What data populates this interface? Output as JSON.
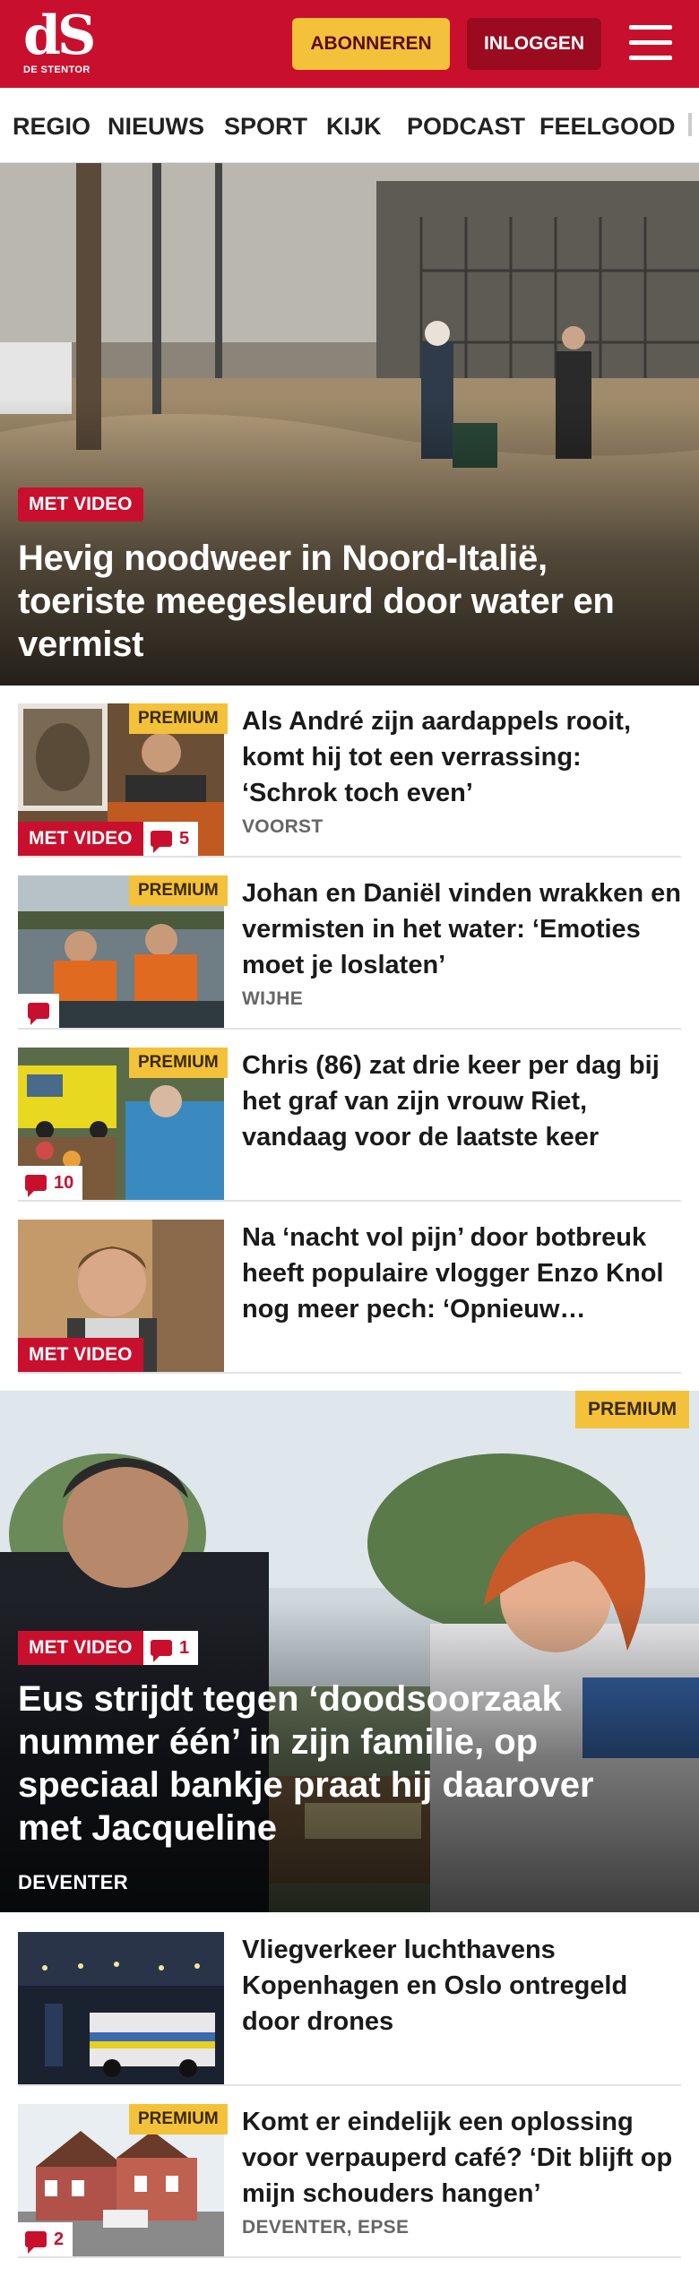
{
  "brand": {
    "logo_mark": "dS",
    "logo_sub": "DE STENTOR",
    "red": "#c8102e",
    "yellow": "#f4c13a"
  },
  "header": {
    "subscribe_label": "ABONNEREN",
    "login_label": "INLOGGEN"
  },
  "nav": {
    "items": [
      "REGIO",
      "NIEUWS",
      "SPORT",
      "KIJK",
      "PODCAST",
      "FEELGOOD"
    ]
  },
  "hero": {
    "badge": "MET VIDEO",
    "title": "Hevig noodweer in Noord-Italië, toeriste meegesleurd door water en vermist"
  },
  "articles": [
    {
      "premium": "PREMIUM",
      "video": "MET VIDEO",
      "comments": "5",
      "title": "Als André zijn aardappels rooit, komt hij tot een verrassing: ‘Schrok toch even’",
      "location": "VOORST"
    },
    {
      "premium": "PREMIUM",
      "title": "Johan en Daniël vinden wrakken en vermisten in het water: ‘Emoties moet je loslaten’",
      "location": "WIJHE"
    },
    {
      "premium": "PREMIUM",
      "comments": "10",
      "title": "Chris (86) zat drie keer per dag bij het graf van zijn vrouw Riet, vandaag voor de laatste keer"
    },
    {
      "video": "MET VIDEO",
      "title": "Na ‘nacht vol pijn’ door botbreuk heeft populaire vlogger Enzo Knol nog meer pech: ‘Opnieuw…"
    }
  ],
  "feature": {
    "premium": "PREMIUM",
    "video": "MET VIDEO",
    "comments": "1",
    "title": "Eus strijdt tegen ‘doodsoorzaak nummer één’ in zijn familie, op speciaal bankje praat hij daarover met Jacqueline",
    "location": "DEVENTER"
  },
  "articles2": [
    {
      "title": "Vliegverkeer luchthavens Kopenhagen en Oslo ontregeld door drones"
    },
    {
      "premium": "PREMIUM",
      "comments": "2",
      "title": "Komt er eindelijk een oplossing voor verpauperd café? ‘Dit blijft op mijn schouders hangen’",
      "location": "DEVENTER, EPSE"
    }
  ]
}
